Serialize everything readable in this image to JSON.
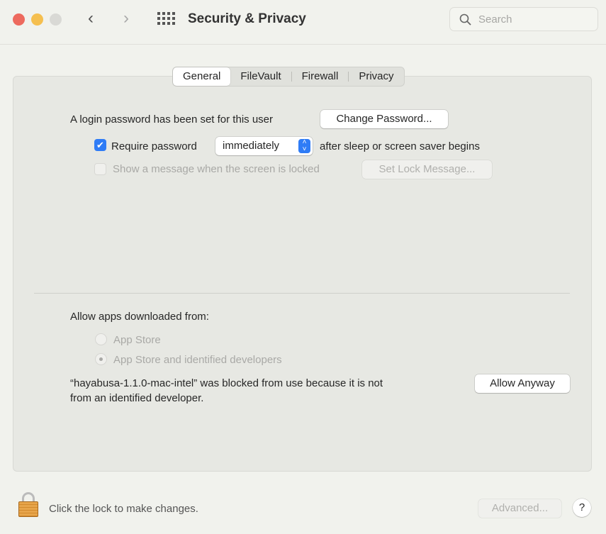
{
  "window": {
    "title": "Security & Privacy",
    "search_placeholder": "Search"
  },
  "tabs": [
    {
      "label": "General",
      "active": true
    },
    {
      "label": "FileVault"
    },
    {
      "label": "Firewall"
    },
    {
      "label": "Privacy"
    }
  ],
  "general": {
    "login_text": "A login password has been set for this user",
    "change_password": "Change Password...",
    "require_password_label": "Require password",
    "require_password_checked": true,
    "require_password_value": "immediately",
    "after_sleep": "after sleep or screen saver begins",
    "show_message_label": "Show a message when the screen is locked",
    "show_message_checked": false,
    "set_lock_message": "Set Lock Message...",
    "allow_apps_label": "Allow apps downloaded from:",
    "options": [
      {
        "label": "App Store",
        "selected": false
      },
      {
        "label": "App Store and identified developers",
        "selected": true
      }
    ],
    "blocked_line1": "“hayabusa-1.1.0-mac-intel” was blocked from use because it is not",
    "blocked_line2": "from an identified developer.",
    "allow_anyway": "Allow Anyway"
  },
  "footer": {
    "lock_text": "Click the lock to make changes.",
    "advanced": "Advanced...",
    "help": "?"
  },
  "colors": {
    "accent": "#2f7cf6",
    "close": "#ed6a5e",
    "minimize": "#f5bf4f",
    "zoom": "#d9d9d5"
  }
}
